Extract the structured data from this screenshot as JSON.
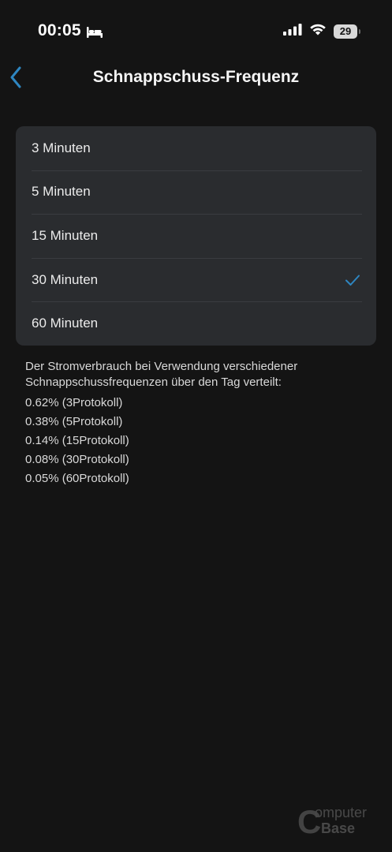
{
  "status_bar": {
    "time": "00:05",
    "battery_level": "29",
    "icons": [
      "bed-icon",
      "signal-icon",
      "wifi-icon",
      "battery-icon"
    ]
  },
  "nav": {
    "title": "Schnappschuss-Frequenz",
    "back_icon": "chevron-left-icon"
  },
  "options": [
    {
      "label": "3 Minuten",
      "selected": false
    },
    {
      "label": "5 Minuten",
      "selected": false
    },
    {
      "label": "15 Minuten",
      "selected": false
    },
    {
      "label": "30 Minuten",
      "selected": true
    },
    {
      "label": "60 Minuten",
      "selected": false
    }
  ],
  "info": {
    "description": "Der Stromverbrauch bei Verwendung verschiedener Schnappschussfrequenzen über den Tag verteilt:",
    "lines": [
      "0.62% (3Protokoll)",
      "0.38% (5Protokoll)",
      "0.14% (15Protokoll)",
      "0.08% (30Protokoll)",
      "0.05% (60Protokoll)"
    ]
  },
  "watermark": {
    "top": "omputer",
    "bottom": "Base",
    "letter": "C"
  },
  "colors": {
    "background": "#141414",
    "card": "#2a2c2f",
    "accent": "#2e86c1",
    "text": "#ececec"
  }
}
